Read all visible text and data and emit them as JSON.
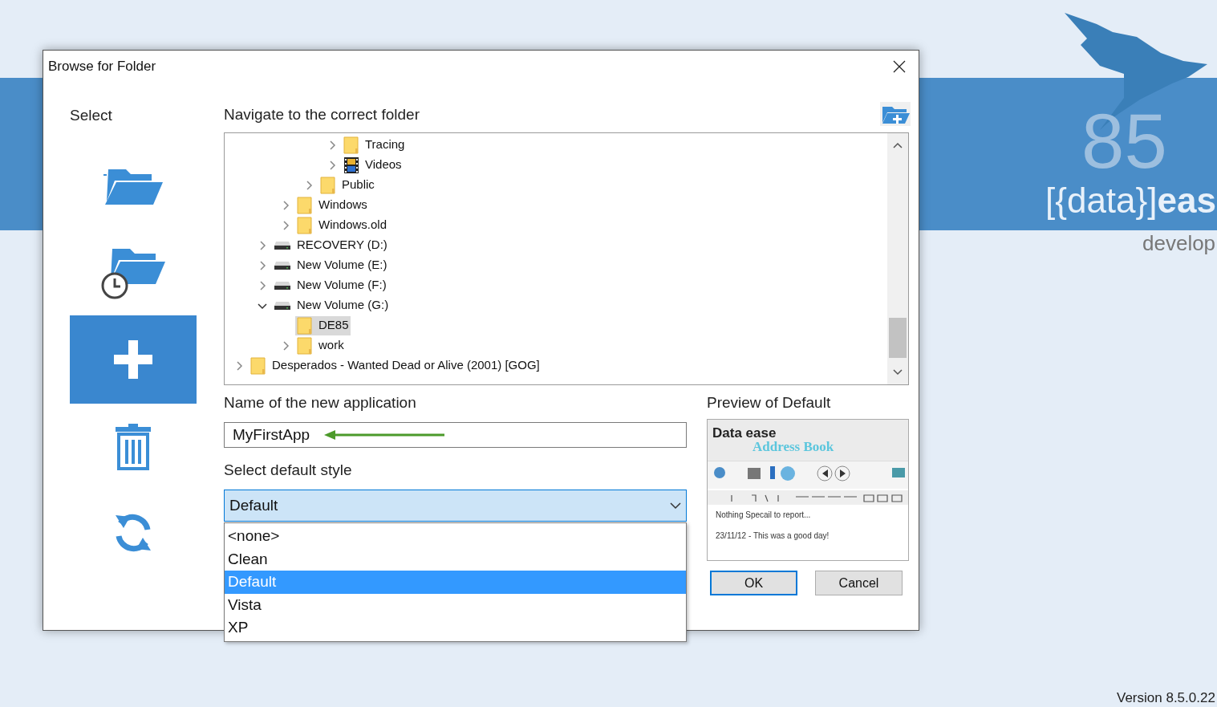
{
  "window": {
    "title": "Browse for Folder"
  },
  "sidebar": {
    "label": "Select",
    "items": [
      {
        "kind": "open",
        "selected": false
      },
      {
        "kind": "recent",
        "selected": false
      },
      {
        "kind": "new",
        "selected": true
      },
      {
        "kind": "delete",
        "selected": false
      },
      {
        "kind": "refresh",
        "selected": false
      }
    ]
  },
  "navigate": {
    "label": "Navigate to the correct folder"
  },
  "tree": [
    {
      "children": [
        {
          "children": [
            {
              "children": [
                {
                  "children": [
                    {
                      "label": "Tracing",
                      "kind": "folder",
                      "expanded": false,
                      "selected": false
                    },
                    {
                      "label": "Videos",
                      "kind": "videos",
                      "expanded": false,
                      "selected": false
                    }
                  ]
                },
                {
                  "label": "Public",
                  "kind": "folder",
                  "expanded": false,
                  "selected": false
                }
              ]
            },
            {
              "label": "Windows",
              "kind": "folder",
              "expanded": false,
              "selected": false
            },
            {
              "label": "Windows.old",
              "kind": "folder",
              "expanded": false,
              "selected": false
            }
          ]
        },
        {
          "label": "RECOVERY (D:)",
          "kind": "drive",
          "expanded": false,
          "selected": false
        },
        {
          "label": "New Volume (E:)",
          "kind": "drive",
          "expanded": false,
          "selected": false
        },
        {
          "label": "New Volume (F:)",
          "kind": "drive",
          "expanded": false,
          "selected": false
        },
        {
          "label": "New Volume (G:)",
          "kind": "drive",
          "expanded": true,
          "selected": false,
          "children": [
            {
              "label": "DE85",
              "kind": "folder",
              "selected": true
            },
            {
              "label": "work",
              "kind": "folder",
              "expanded": false,
              "selected": false
            }
          ]
        }
      ]
    },
    {
      "label": "Desperados - Wanted Dead or Alive (2001) [GOG]",
      "kind": "folder",
      "expanded": false,
      "selected": false
    }
  ],
  "name_field": {
    "label": "Name of the new application",
    "value": "MyFirstApp"
  },
  "style_select": {
    "label": "Select default style",
    "value": "Default",
    "expanded": true,
    "options": [
      {
        "label": "<none>",
        "selected": false
      },
      {
        "label": "Clean",
        "selected": false
      },
      {
        "label": "Default",
        "selected": true
      },
      {
        "label": "Vista",
        "selected": false
      },
      {
        "label": "XP",
        "selected": false
      }
    ]
  },
  "preview": {
    "label": "Preview of Default",
    "logo": "Data ease",
    "subtitle": "Address Book",
    "lines": [
      "Nothing Specail to report...",
      "23/11/12 - This was a good day!"
    ]
  },
  "buttons": [
    {
      "label": "OK",
      "kind": "default"
    },
    {
      "label": "Cancel",
      "kind": "normal"
    }
  ],
  "splash": {
    "number": "85",
    "brand": "[{data}]**eas**",
    "tagline": "develop",
    "version": "Version 8.5.0.22"
  }
}
